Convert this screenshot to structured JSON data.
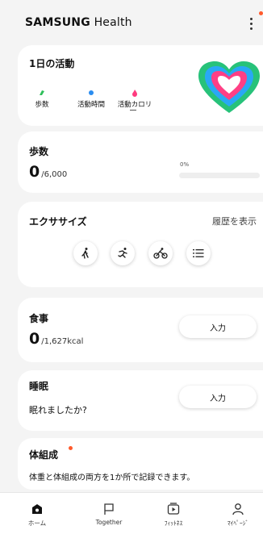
{
  "header": {
    "brand_part1": "SAMSUNG",
    "brand_part2": " Health",
    "menu_icon": "more-vertical-icon",
    "notification_color": "#ff5a2c"
  },
  "activity": {
    "title": "1日の活動",
    "items": [
      {
        "label": "歩数",
        "color": "#2fbf5a"
      },
      {
        "label": "活動時間",
        "color": "#2a8df0"
      },
      {
        "label": "活動カロリ",
        "color": "#ff3b7f"
      }
    ]
  },
  "steps": {
    "title": "歩数",
    "value": "0",
    "goal": "/6,000",
    "percent_label": "0%",
    "progress": 0
  },
  "exercise": {
    "title": "エクササイズ",
    "history_link": "履歴を表示",
    "icons": [
      "walking-icon",
      "running-icon",
      "cycling-icon",
      "list-icon"
    ]
  },
  "food": {
    "title": "食事",
    "value": "0",
    "goal": "/1,627kcal",
    "button": "入力"
  },
  "sleep": {
    "title": "睡眠",
    "question": "眠れましたか?",
    "button": "入力"
  },
  "body": {
    "title": "体組成",
    "description": "体重と体組成の両方を1か所で記録できます。"
  },
  "nav": [
    {
      "label": "ホーム",
      "icon": "home-icon",
      "active": true
    },
    {
      "label": "Together",
      "icon": "flag-icon",
      "active": false
    },
    {
      "label": "ﾌｨｯﾄﾈｽ",
      "icon": "play-video-icon",
      "active": false
    },
    {
      "label": "ﾏｲﾍﾟｰｼﾞ",
      "icon": "person-icon",
      "active": false
    }
  ]
}
